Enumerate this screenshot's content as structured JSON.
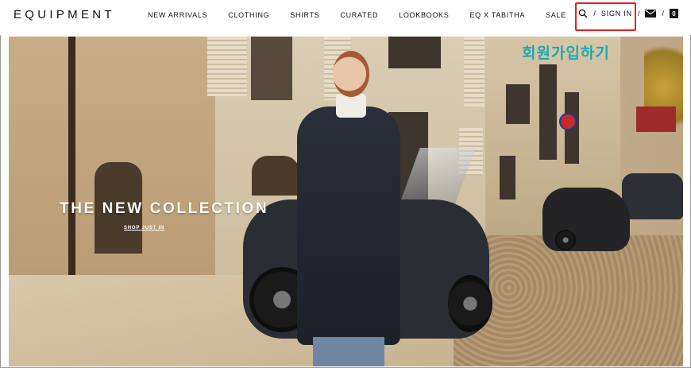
{
  "header": {
    "logo": "EQUIPMENT",
    "nav": [
      {
        "label": "NEW ARRIVALS"
      },
      {
        "label": "CLOTHING"
      },
      {
        "label": "SHIRTS"
      },
      {
        "label": "CURATED"
      },
      {
        "label": "LOOKBOOKS"
      },
      {
        "label": "EQ X TABITHA"
      },
      {
        "label": "SALE"
      }
    ],
    "utility": {
      "separator": "/",
      "sign_in": "SIGN IN",
      "icons": [
        "search-icon",
        "mail-icon",
        "bag-icon"
      ],
      "bag_count": "0"
    }
  },
  "hero": {
    "headline": "THE NEW COLLECTION",
    "cta": "SHOP JUST IN"
  },
  "annotation": {
    "text": "회원가입하기",
    "color": "#1fa7b0",
    "highlight_color": "#e32222"
  }
}
